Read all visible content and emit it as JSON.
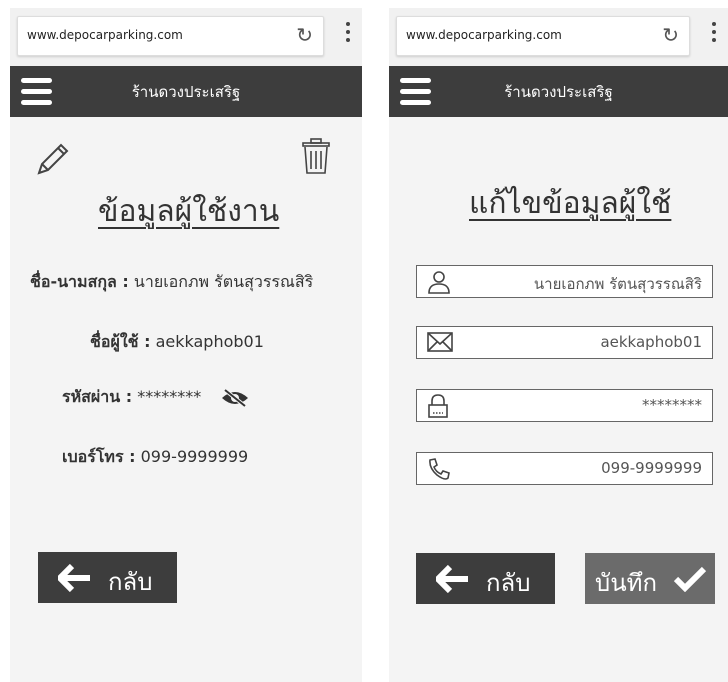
{
  "browser": {
    "url": "www.depocarparking.com"
  },
  "app": {
    "shop_name": "ร้านดวงประเสริฐ"
  },
  "view": {
    "title": "ข้อมูลผู้ใช้งาน",
    "fullname_label": "ชื่อ-นามสกุล :",
    "fullname_value": "นายเอกภพ รัตนสุวรรณสิริ",
    "username_label": "ชื่อผู้ใช้ :",
    "username_value": "aekkaphob01",
    "password_label": "รหัสผ่าน :",
    "password_value": "********",
    "phone_label": "เบอร์โทร :",
    "phone_value": "099-9999999",
    "back_label": "กลับ"
  },
  "edit": {
    "title": "แก้ไขข้อมูลผู้ใช้",
    "fullname_value": "นายเอกภพ รัตนสุวรรณสิริ",
    "email_value": "aekkaphob01",
    "password_value": "********",
    "phone_value": "099-9999999",
    "back_label": "กลับ",
    "save_label": "บันทึก"
  },
  "colors": {
    "header": "#3d3d3d",
    "save_button": "#6b6b6b",
    "background": "#f4f4f4"
  },
  "icons": [
    "reload-icon",
    "menu-icon",
    "pencil-icon",
    "trash-icon",
    "eye-slash-icon",
    "arrow-left-icon",
    "user-icon",
    "mail-icon",
    "lock-icon",
    "phone-icon",
    "check-icon"
  ]
}
